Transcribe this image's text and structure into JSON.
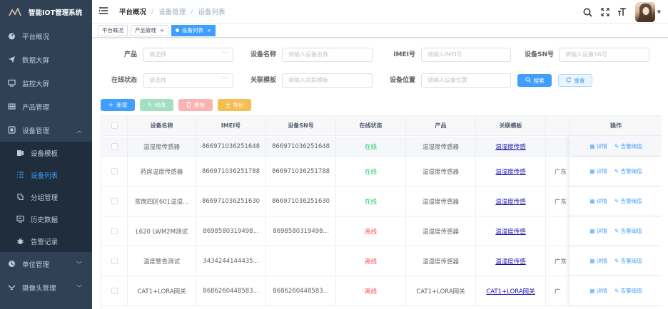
{
  "app_title": "智能IOT管理系统",
  "sidebar": {
    "items": [
      {
        "label": "平台概况",
        "icon": "dashboard-icon"
      },
      {
        "label": "数据大屏",
        "icon": "send-icon"
      },
      {
        "label": "监控大屏",
        "icon": "monitor-icon"
      },
      {
        "label": "产品管理",
        "icon": "grid-icon"
      },
      {
        "label": "设备管理",
        "icon": "device-icon",
        "expanded": true,
        "children": [
          {
            "label": "设备模板",
            "icon": "template-icon"
          },
          {
            "label": "设备列表",
            "icon": "list-icon",
            "active": true
          },
          {
            "label": "分组管理",
            "icon": "group-icon"
          },
          {
            "label": "历史数据",
            "icon": "history-icon"
          },
          {
            "label": "告警记录",
            "icon": "bug-icon"
          }
        ]
      },
      {
        "label": "单位管理",
        "icon": "unit-icon"
      },
      {
        "label": "摄像头管理",
        "icon": "camera-icon"
      }
    ]
  },
  "breadcrumb": [
    "平台概况",
    "设备管理",
    "设备列表"
  ],
  "tags": [
    {
      "label": "平台概况",
      "closable": false,
      "active": false
    },
    {
      "label": "产品管理",
      "closable": true,
      "active": false
    },
    {
      "label": "设备列表",
      "closable": true,
      "active": true
    }
  ],
  "search": {
    "fields": [
      {
        "label": "产品",
        "placeholder": "请选择",
        "type": "select"
      },
      {
        "label": "设备名称",
        "placeholder": "请输入设备名称",
        "type": "input"
      },
      {
        "label": "IMEI号",
        "placeholder": "请输入IMEI号",
        "type": "input"
      },
      {
        "label": "设备SN号",
        "placeholder": "请输入设备SN号",
        "type": "input"
      },
      {
        "label": "在线状态",
        "placeholder": "请选择",
        "type": "select"
      },
      {
        "label": "关联模板",
        "placeholder": "请输入关联模板",
        "type": "input"
      },
      {
        "label": "设备位置",
        "placeholder": "请输入设备位置",
        "type": "input"
      }
    ],
    "search_label": "搜索",
    "reset_label": "重置"
  },
  "actions": {
    "add": "新增",
    "edit": "修改",
    "delete": "删除",
    "export": "导出"
  },
  "table": {
    "columns": [
      "设备名称",
      "IMEI号",
      "设备SN号",
      "在线状态",
      "产品",
      "关联模板",
      "",
      "操作"
    ],
    "rows": [
      {
        "name": "温湿度传感器",
        "imei": "866971036251648",
        "sn": "866971036251648",
        "status": "在线",
        "status_kind": "online",
        "product": "温湿度传感器",
        "template": "温湿度传感",
        "region": ""
      },
      {
        "name": "药房温度传感器",
        "imei": "866971036251788",
        "sn": "866971036251788",
        "status": "在线",
        "status_kind": "online",
        "product": "温湿度传感器",
        "template": "温湿度传感",
        "region": "广东"
      },
      {
        "name": "翠岗四区601温湿...",
        "imei": "866971036251630",
        "sn": "866971036251630",
        "status": "在线",
        "status_kind": "online",
        "product": "温湿度传感器",
        "template": "温湿度传感",
        "region": "广东"
      },
      {
        "name": "L620 LWM2M测试",
        "imei": "8698580319498...",
        "sn": "8698580319498...",
        "status": "离线",
        "status_kind": "offline",
        "product": "温湿度传感器",
        "template": "温湿度传感",
        "region": ""
      },
      {
        "name": "温度警告测试",
        "imei": "3434244144435...",
        "sn": "",
        "status": "离线",
        "status_kind": "offline",
        "product": "温湿度传感器",
        "template": "温湿度传感",
        "region": "广东"
      },
      {
        "name": "CAT1+LORA网关",
        "imei": "8686260448583...",
        "sn": "8686260448583...",
        "status": "离线",
        "status_kind": "offline",
        "product": "CAT1+LORA网关",
        "template": "CAT1+LORA网关",
        "region": "广"
      }
    ],
    "op_detail": "详情",
    "op_alarm": "告警阈值"
  },
  "colors": {
    "sidebar_bg": "#304156",
    "primary": "#409eff",
    "online": "#13ce66",
    "offline": "#ff4949"
  }
}
